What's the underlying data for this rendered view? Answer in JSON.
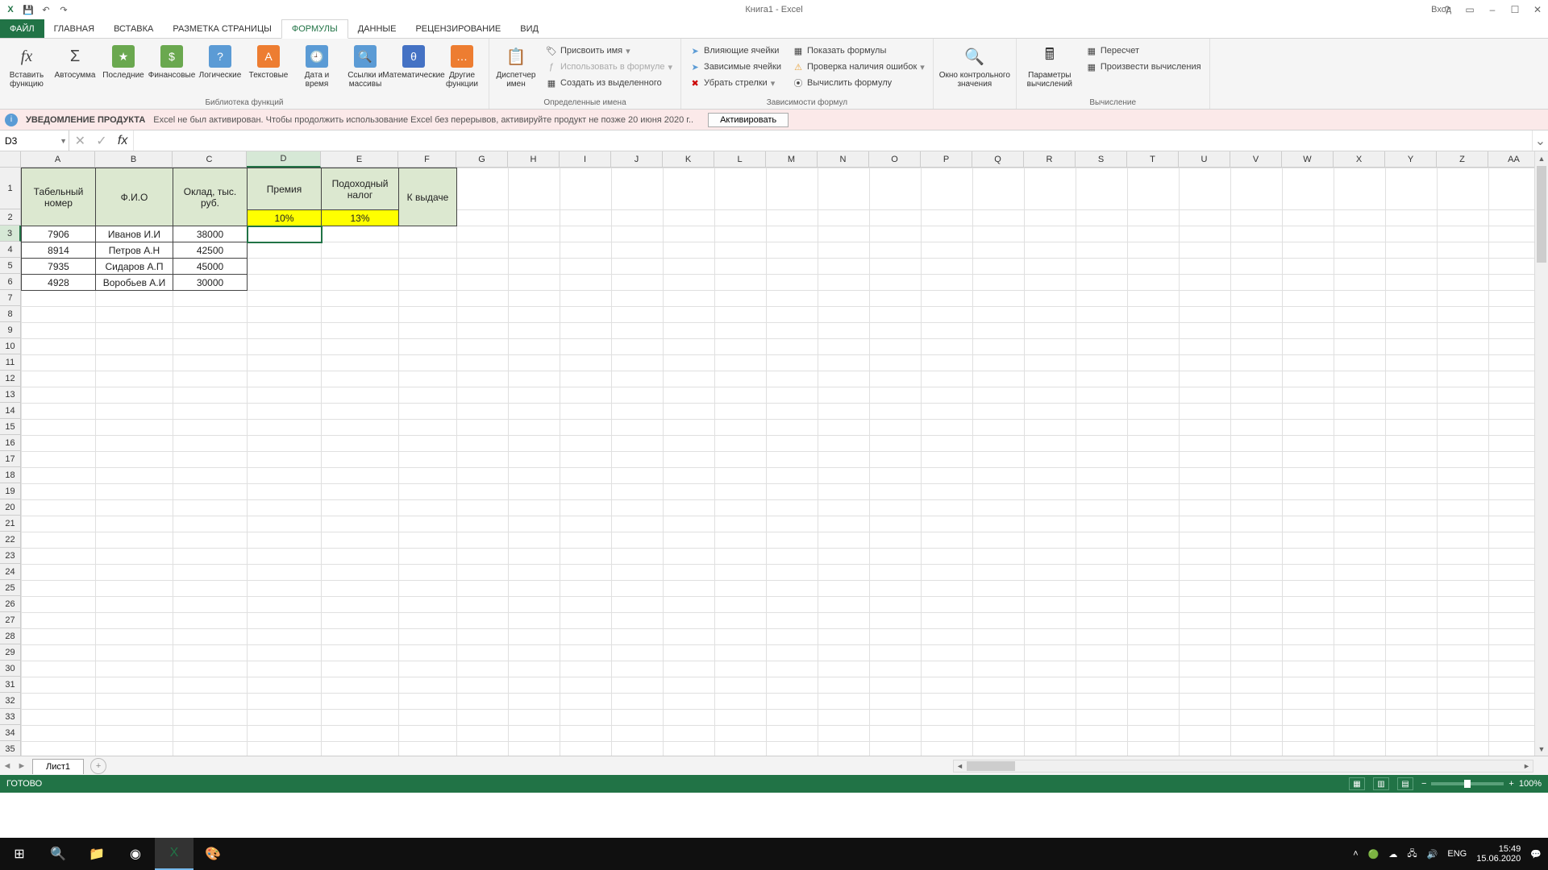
{
  "title": "Книга1 - Excel",
  "login": "Вход",
  "qat": {
    "save": "💾",
    "undo": "↶",
    "redo": "↷"
  },
  "tabs": [
    "ФАЙЛ",
    "ГЛАВНАЯ",
    "ВСТАВКА",
    "РАЗМЕТКА СТРАНИЦЫ",
    "ФОРМУЛЫ",
    "ДАННЫЕ",
    "РЕЦЕНЗИРОВАНИЕ",
    "ВИД"
  ],
  "active_tab_index": 4,
  "ribbon": {
    "group1": {
      "label": "Библиотека функций",
      "insert_fn": "Вставить функцию",
      "autosum": "Автосумма",
      "recent": "Последние",
      "financial": "Финансовые",
      "logical": "Логические",
      "text": "Текстовые",
      "datetime": "Дата и время",
      "lookup": "Ссылки и массивы",
      "math": "Математические",
      "more": "Другие функции"
    },
    "group2": {
      "label": "Определенные имена",
      "name_mgr": "Диспетчер имен",
      "define": "Присвоить имя",
      "use": "Использовать в формуле",
      "create": "Создать из выделенного"
    },
    "group3": {
      "label": "Зависимости формул",
      "trace_prec": "Влияющие ячейки",
      "trace_dep": "Зависимые ячейки",
      "remove_arrows": "Убрать стрелки",
      "show_formulas": "Показать формулы",
      "error_check": "Проверка наличия ошибок",
      "evaluate": "Вычислить формулу"
    },
    "group4": {
      "label": "",
      "watch": "Окно контрольного значения"
    },
    "group5": {
      "label": "Вычисление",
      "options": "Параметры вычислений",
      "recalc": "Пересчет",
      "calc_now": "Произвести вычисления"
    }
  },
  "notification": {
    "title": "УВЕДОМЛЕНИЕ ПРОДУКТА",
    "text": "Excel не был активирован. Чтобы продолжить использование Excel без перерывов, активируйте продукт не позже 20 июня 2020 г..",
    "button": "Активировать"
  },
  "namebox": "D3",
  "formula": "",
  "columns": [
    "A",
    "B",
    "C",
    "D",
    "E",
    "F",
    "G",
    "H",
    "I",
    "J",
    "K",
    "L",
    "M",
    "N",
    "O",
    "P",
    "Q",
    "R",
    "S",
    "T",
    "U",
    "V",
    "W",
    "X",
    "Y",
    "Z",
    "AA"
  ],
  "col_widths": {
    "A": 92,
    "B": 96,
    "C": 92,
    "D": 92,
    "E": 96,
    "F": 72,
    "default": 64
  },
  "selected_col": "D",
  "selected_row": 3,
  "row1_height": 52,
  "headers": [
    "Табельный номер",
    "Ф.И.О",
    "Оклад, тыс. руб.",
    "Премия",
    "Подоходный налог",
    "К выдаче"
  ],
  "row2": {
    "D": "10%",
    "E": "13%"
  },
  "data_rows": [
    {
      "A": "7906",
      "B": "Иванов И.И",
      "C": "38000"
    },
    {
      "A": "8914",
      "B": "Петров А.Н",
      "C": "42500"
    },
    {
      "A": "7935",
      "B": "Сидаров А.П",
      "C": "45000"
    },
    {
      "A": "4928",
      "B": "Воробьев А.И",
      "C": "30000"
    }
  ],
  "sheet_tab": "Лист1",
  "status": "ГОТОВО",
  "zoom": "100%",
  "taskbar": {
    "lang": "ENG",
    "time": "15:49",
    "date": "15.06.2020"
  }
}
